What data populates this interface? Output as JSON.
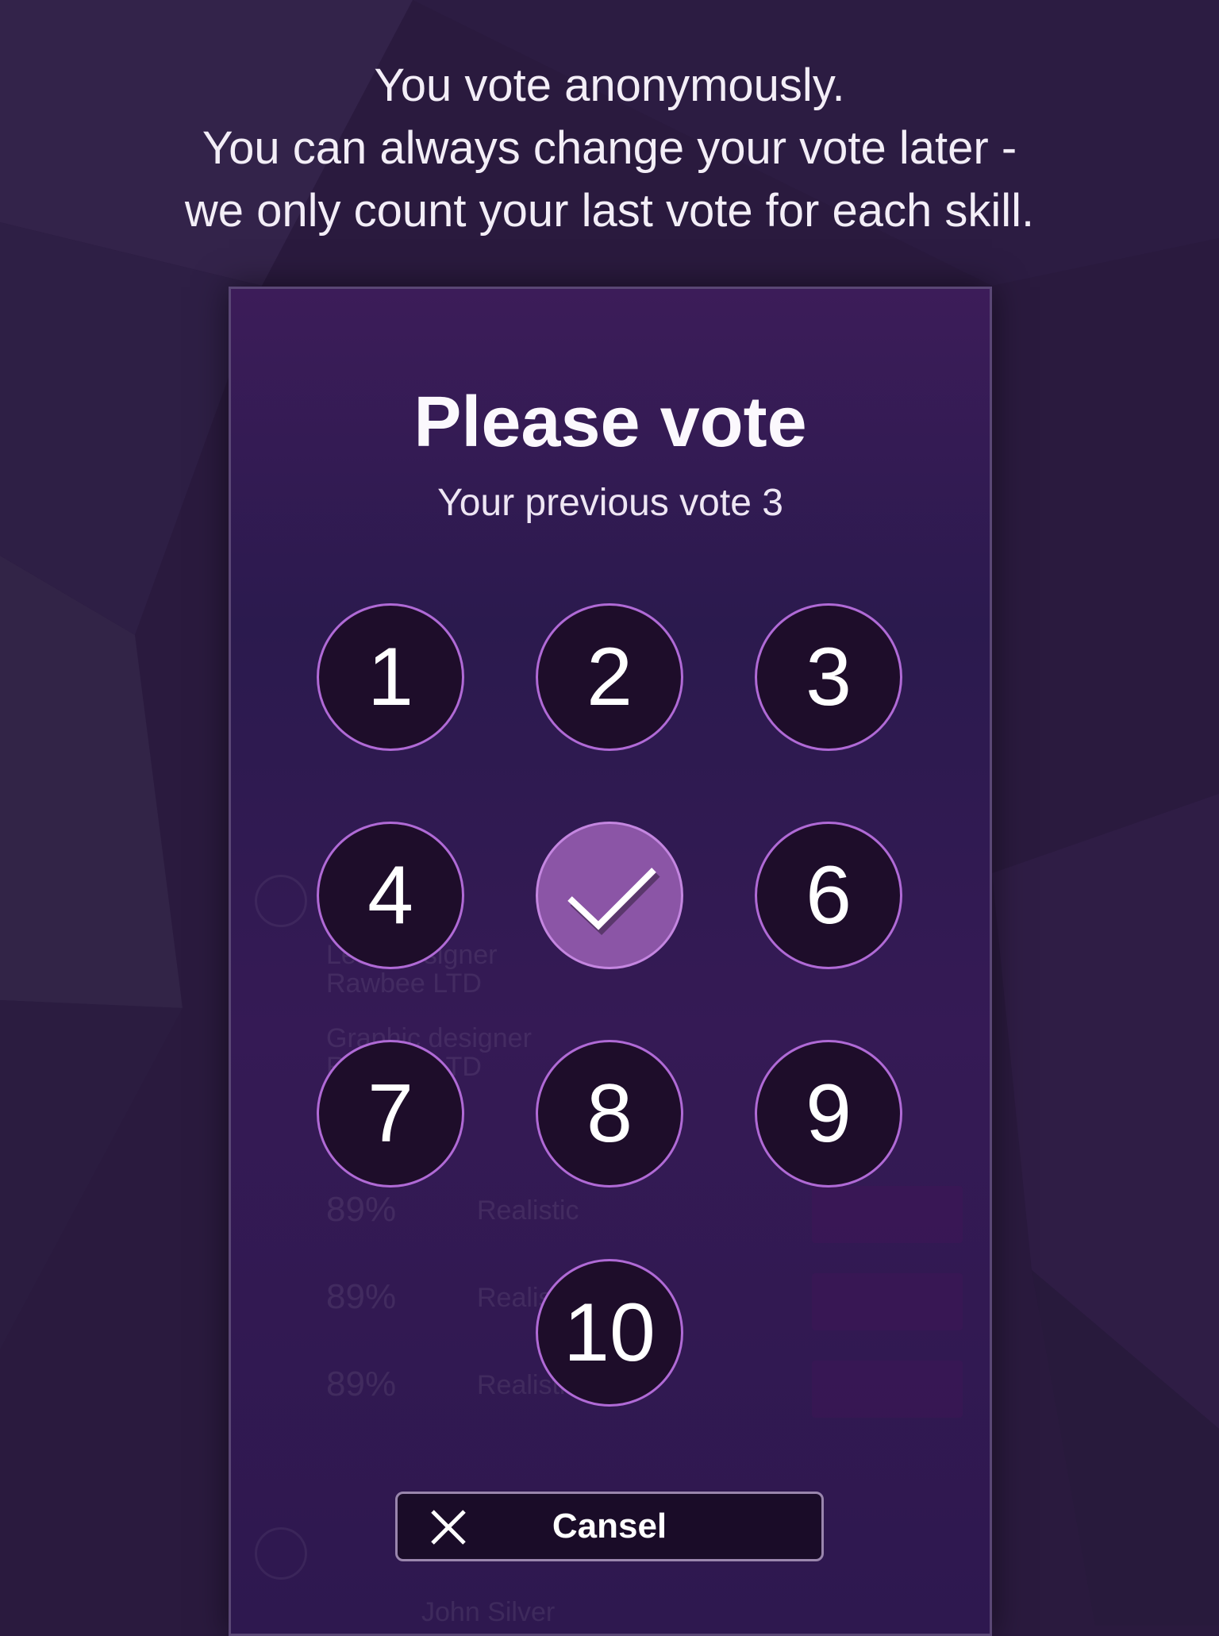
{
  "intro": {
    "line1": "You vote anonymously.",
    "line2": "You can always change your vote later -",
    "line3": "we only count your last vote for each skill."
  },
  "dialog": {
    "title": "Please vote",
    "subtitle": "Your previous vote 3",
    "keys": [
      "1",
      "2",
      "3",
      "4",
      "5",
      "6",
      "7",
      "8",
      "9",
      "10"
    ],
    "selected_key": "5",
    "cancel_label": "Cansel"
  },
  "background": {
    "text1": "Lead designer",
    "text2": "Rawbee LTD",
    "text3": "Graphic designer",
    "text4": "Rawbee LTD",
    "pct1": "89%",
    "pct2": "89%",
    "pct3": "89%",
    "rate1": "Realistic",
    "rate2": "Realistic",
    "rate3": "Realistic",
    "name": "John Silver"
  },
  "colors": {
    "accent": "#b06ad6",
    "selected": "#8b55a6",
    "panel": "#2b1a4e"
  }
}
